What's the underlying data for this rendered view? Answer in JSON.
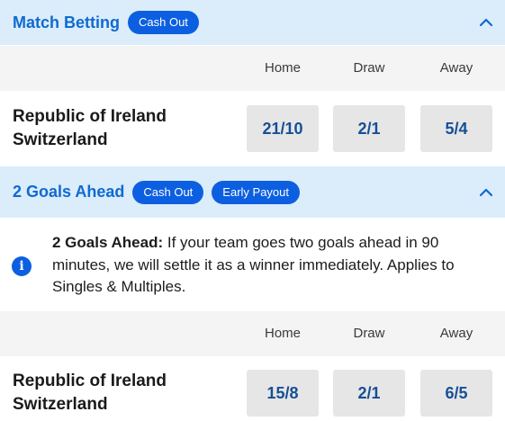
{
  "market1": {
    "title": "Match Betting",
    "badges": [
      "Cash Out"
    ],
    "columns": [
      "Home",
      "Draw",
      "Away"
    ],
    "teams": [
      "Republic of Ireland",
      "Switzerland"
    ],
    "odds": [
      "21/10",
      "2/1",
      "5/4"
    ]
  },
  "market2": {
    "title": "2 Goals Ahead",
    "badges": [
      "Cash Out",
      "Early Payout"
    ],
    "info": {
      "heading": "2 Goals Ahead:",
      "text": " If your team goes two goals ahead in 90 minutes, we will settle it as a winner immediately. Applies to Singles & Multiples."
    },
    "columns": [
      "Home",
      "Draw",
      "Away"
    ],
    "teams": [
      "Republic of Ireland",
      "Switzerland"
    ],
    "odds": [
      "15/8",
      "2/1",
      "6/5"
    ]
  },
  "icons": {
    "collapse": "chevron-up-icon",
    "info": "info-icon"
  },
  "colors": {
    "header_bg": "#dbecfb",
    "accent": "#0f6ad1",
    "pill": "#0c5fe0",
    "odds_text": "#164f96",
    "odds_bg": "#e6e6e6"
  }
}
